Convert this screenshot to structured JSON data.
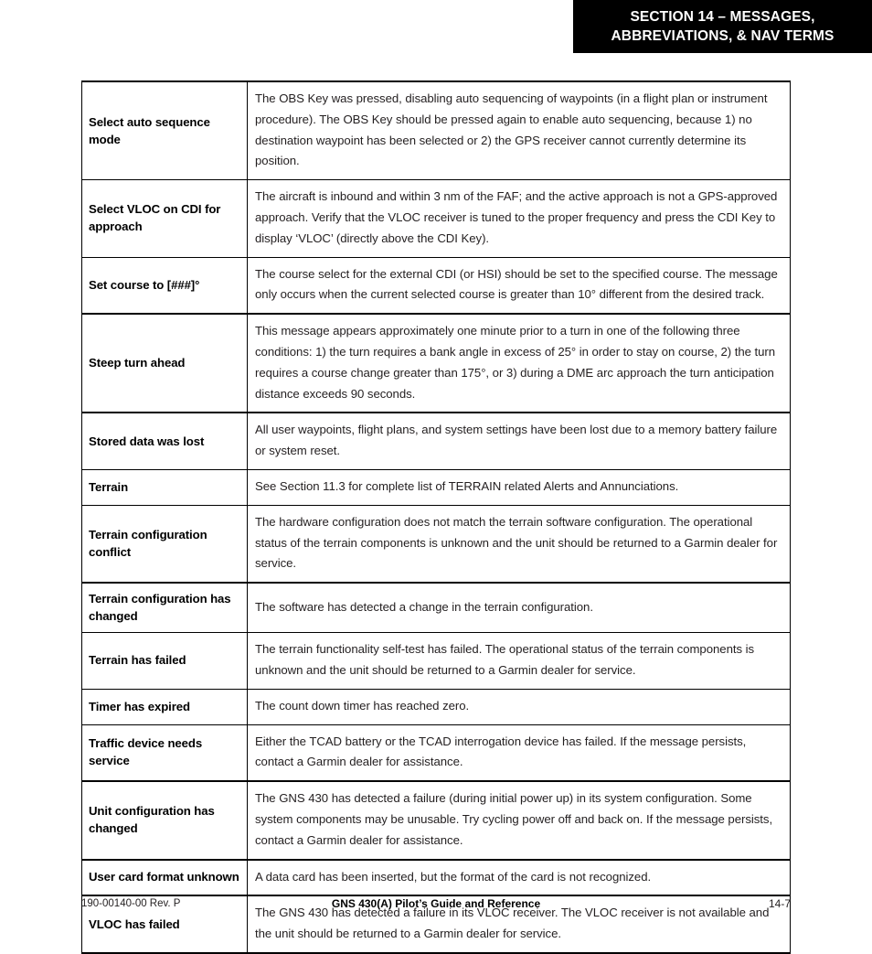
{
  "header": {
    "line1": "SECTION 14 – MESSAGES,",
    "line2": "ABBREVIATIONS, & NAV TERMS",
    "background_color": "#000000",
    "text_color": "#ffffff"
  },
  "table": {
    "rows": [
      {
        "message": "Select auto sequence mode",
        "description": "The OBS Key was pressed, disabling auto sequencing of waypoints (in a flight plan or instrument procedure).  The OBS Key should be pressed again to enable auto sequencing, because 1) no destination waypoint has been selected or 2) the GPS receiver cannot currently determine its position."
      },
      {
        "message": "Select VLOC on CDI for approach",
        "description": "The aircraft is inbound and within 3 nm of the FAF; and the active approach is not a GPS-approved approach.  Verify that the VLOC receiver is tuned to the proper frequency and press the CDI Key to display ‘VLOC’ (directly above the CDI Key)."
      },
      {
        "message": "Set course to [###]°",
        "description": "The course select for the external CDI (or HSI) should be set to the specified course.  The message only occurs when the current selected course is greater than 10° different from the desired track."
      },
      {
        "message": "Steep turn ahead",
        "description": "This message appears approximately one minute prior to a turn in one of the following three conditions: 1) the turn requires a bank angle in excess of 25° in order to stay on course, 2) the turn requires a course change greater than 175°, or 3) during a DME arc approach the turn anticipation distance exceeds 90 seconds."
      },
      {
        "message": "Stored data was lost",
        "description": "All user waypoints, flight plans, and system settings have been lost due to a memory battery failure or system reset."
      },
      {
        "message": "Terrain",
        "description": "See Section 11.3 for complete list of TERRAIN related Alerts and Annunciations."
      },
      {
        "message": "Terrain configuration conflict",
        "description": "The hardware configuration does not match the terrain software configuration.  The operational status of the terrain components is unknown and the unit should be returned to a Garmin dealer for service."
      },
      {
        "message": "Terrain configuration has changed",
        "description": "The software has detected a change in the terrain configuration."
      },
      {
        "message": "Terrain has failed",
        "description": "The terrain functionality self-test has failed.  The operational status of the terrain components is unknown and the unit should be returned to a Garmin dealer for service."
      },
      {
        "message": "Timer has expired",
        "description": "The count down timer has reached zero."
      },
      {
        "message": "Traffic device needs service",
        "description": "Either the TCAD battery or the TCAD interrogation device has failed.  If the message persists, contact a Garmin dealer for assistance."
      },
      {
        "message": "Unit configuration has changed",
        "description": "The GNS 430 has detected a failure (during initial power up) in its system configuration. Some system components may be unusable.  Try cycling power off and back on. If the message persists, contact a Garmin dealer for assistance."
      },
      {
        "message": "User card format unknown",
        "description": "A data card has been inserted, but the format of the card is not recognized."
      },
      {
        "message": "VLOC has failed",
        "description": "The GNS 430 has detected a failure in its VLOC receiver.  The VLOC receiver is not available and the unit should be returned to a Garmin dealer for service."
      }
    ]
  },
  "footer": {
    "doc_id": "190-00140-00  Rev. P",
    "title": "GNS 430(A) Pilot’s Guide and Reference",
    "page_number": "14-7"
  }
}
